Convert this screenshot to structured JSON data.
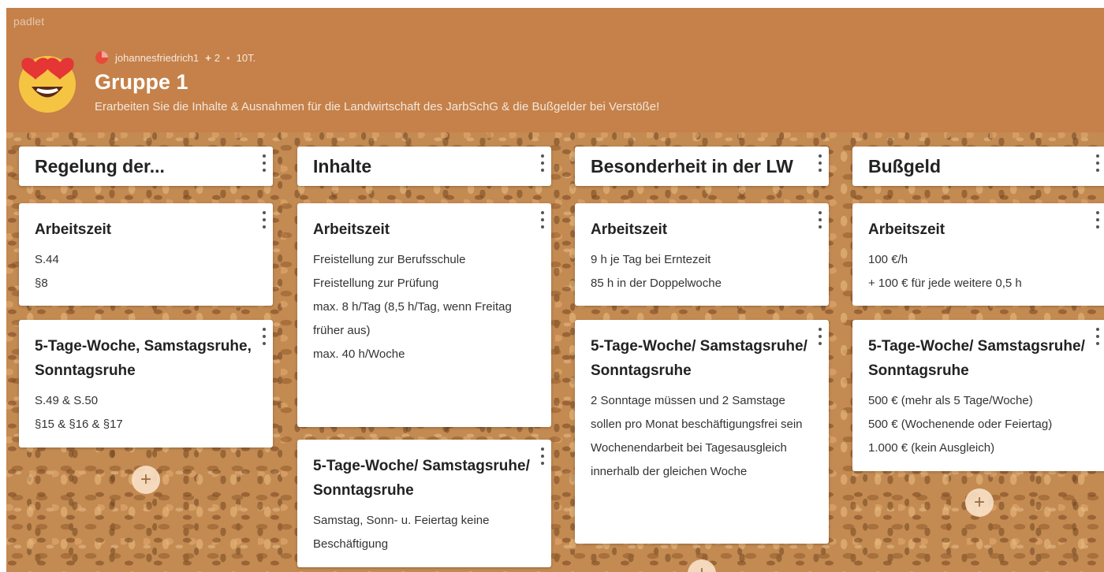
{
  "brand": "padlet",
  "header": {
    "user": "johannesfriedrich1",
    "plus": "+",
    "contributors": "2",
    "separator": "•",
    "age": "10T.",
    "title": "Gruppe 1",
    "subtitle": "Erarbeiten Sie die Inhalte & Ausnahmen für die Landwirtschaft des JarbSchG & die Bußgelder bei Verstöße!"
  },
  "add_label": "+",
  "columns": [
    {
      "title": "Regelung der...",
      "posts": [
        {
          "title": "Arbeitszeit",
          "lines": [
            "S.44",
            "§8"
          ]
        },
        {
          "title": "5-Tage-Woche, Samstagsruhe, Sonntagsruhe",
          "lines": [
            "S.49 & S.50",
            "§15 & §16 & §17"
          ]
        }
      ]
    },
    {
      "title": "Inhalte",
      "posts": [
        {
          "title": "Arbeitszeit",
          "lines": [
            "Freistellung zur Berufsschule",
            "Freistellung zur Prüfung",
            "max. 8 h/Tag (8,5 h/Tag, wenn Freitag früher aus)",
            "max. 40 h/Woche"
          ]
        },
        {
          "title": "5-Tage-Woche/ Samstagsruhe/ Sonntagsruhe",
          "lines": [
            "Samstag, Sonn- u. Feiertag keine Beschäftigung"
          ]
        }
      ]
    },
    {
      "title": "Besonderheit in der LW",
      "posts": [
        {
          "title": "Arbeitszeit",
          "lines": [
            "9 h je Tag bei Erntezeit",
            "85 h in der Doppelwoche"
          ]
        },
        {
          "title": "5-Tage-Woche/ Samstagsruhe/ Sonntagsruhe",
          "lines": [
            "2 Sonntage müssen und 2 Samstage sollen pro Monat beschäftigungsfrei sein",
            "Wochenendarbeit bei Tagesausgleich innerhalb der gleichen Woche"
          ]
        }
      ]
    },
    {
      "title": "Bußgeld",
      "posts": [
        {
          "title": "Arbeitszeit",
          "lines": [
            "100 €/h",
            "+ 100 € für jede weitere 0,5 h"
          ]
        },
        {
          "title": "5-Tage-Woche/ Samstagsruhe/ Sonntagsruhe",
          "lines": [
            "500 € (mehr als 5 Tage/Woche)",
            "500 € (Wochenende oder Feiertag)",
            "1.000 € (kein Ausgleich)"
          ]
        }
      ]
    }
  ]
}
